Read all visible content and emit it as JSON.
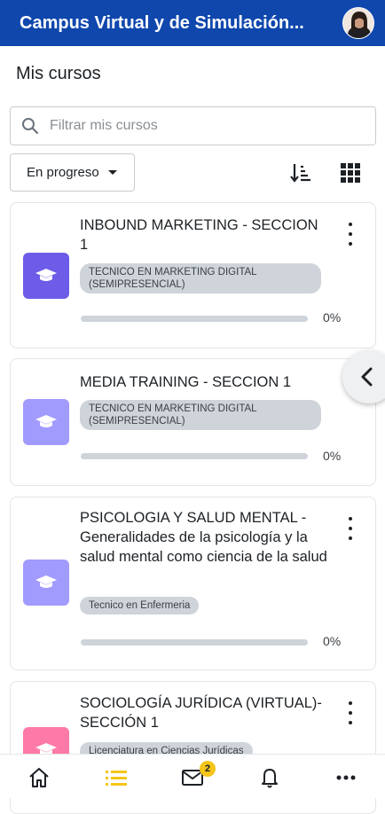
{
  "app": {
    "title": "Campus Virtual y de Simulación...",
    "accent": "#0f47ad"
  },
  "page": {
    "title": "Mis cursos"
  },
  "search": {
    "placeholder": "Filtrar mis cursos",
    "value": ""
  },
  "filter": {
    "selected": "En progreso"
  },
  "toolbar": {
    "sort_icon": "sort-icon",
    "view_icon": "grid-view-icon"
  },
  "courses": [
    {
      "name": "INBOUND MARKETING - SECCION 1",
      "category": "TECNICO EN MARKETING DIGITAL (SEMIPRESENCIAL)",
      "progress_label": "0%",
      "progress": 0,
      "icon_color": "#6c5ce7"
    },
    {
      "name": "MEDIA TRAINING - SECCION 1",
      "category": "TECNICO EN MARKETING DIGITAL (SEMIPRESENCIAL)",
      "progress_label": "0%",
      "progress": 0,
      "icon_color": "#a29bfe"
    },
    {
      "name": "PSICOLOGIA Y SALUD MENTAL - Generalidades de la psicología y la salud mental como ciencia de la salud",
      "category": "Tecnico en Enfermeria",
      "progress_label": "0%",
      "progress": 0,
      "icon_color": "#a29bfe"
    },
    {
      "name": "SOCIOLOGÍA JURÍDICA (VIRTUAL)- SECCIÓN 1",
      "category": "Licenciatura en Ciencias Jurídicas",
      "progress_label": "",
      "progress": 0,
      "icon_color": "#fd79a8"
    }
  ],
  "bottom_nav": {
    "items": [
      "home-icon",
      "my-courses-icon",
      "messages-icon",
      "notifications-icon",
      "more-icon"
    ],
    "messages_badge": "2",
    "active_color": "#f5c518"
  }
}
